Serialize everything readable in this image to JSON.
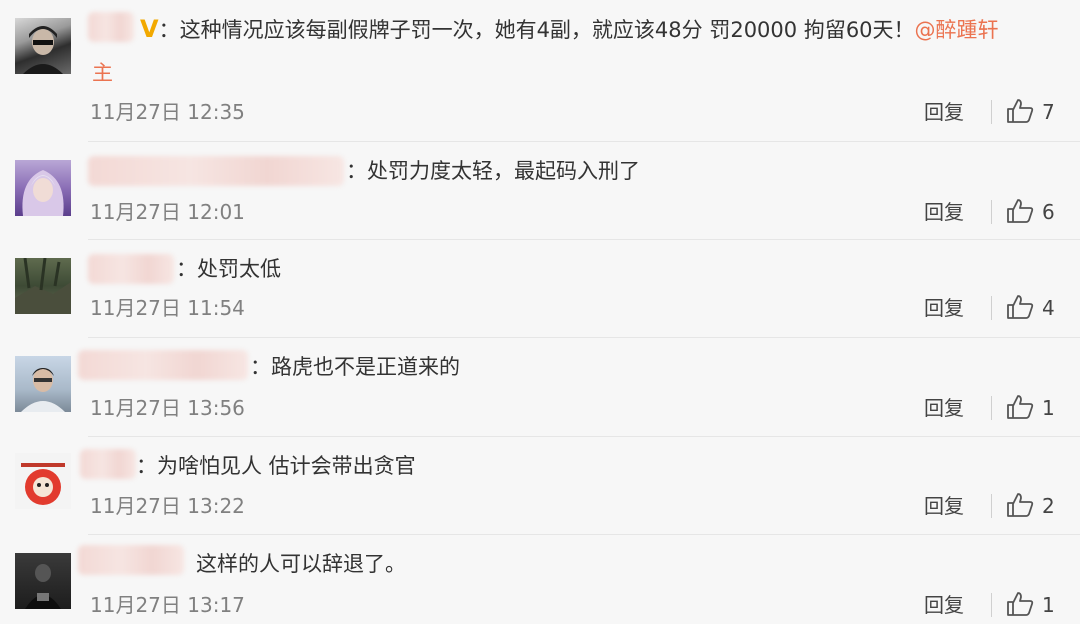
{
  "reply_label": "回复",
  "colors": {
    "mention": "#eb7350",
    "vip_badge": "#f2a900",
    "timestamp": "#808080",
    "background": "#f7f7f7"
  },
  "comments": [
    {
      "badge": "V",
      "text": "：这种情况应该每副假牌子罚一次，她有4副，就应该48分 罚20000 拘留60天！",
      "mention": "@醉踵轩",
      "mention_cont": "主",
      "time": "11月27日 12:35",
      "likes": "7"
    },
    {
      "text": "：处罚力度太轻，最起码入刑了",
      "time": "11月27日 12:01",
      "likes": "6"
    },
    {
      "text": "：处罚太低",
      "time": "11月27日 11:54",
      "likes": "4"
    },
    {
      "text": "：路虎也不是正道来的",
      "time": "11月27日 13:56",
      "likes": "1"
    },
    {
      "text": "：为啥怕见人 估计会带出贪官",
      "time": "11月27日 13:22",
      "likes": "2"
    },
    {
      "text": "这样的人可以辞退了。",
      "time": "11月27日 13:17",
      "likes": "1"
    }
  ]
}
